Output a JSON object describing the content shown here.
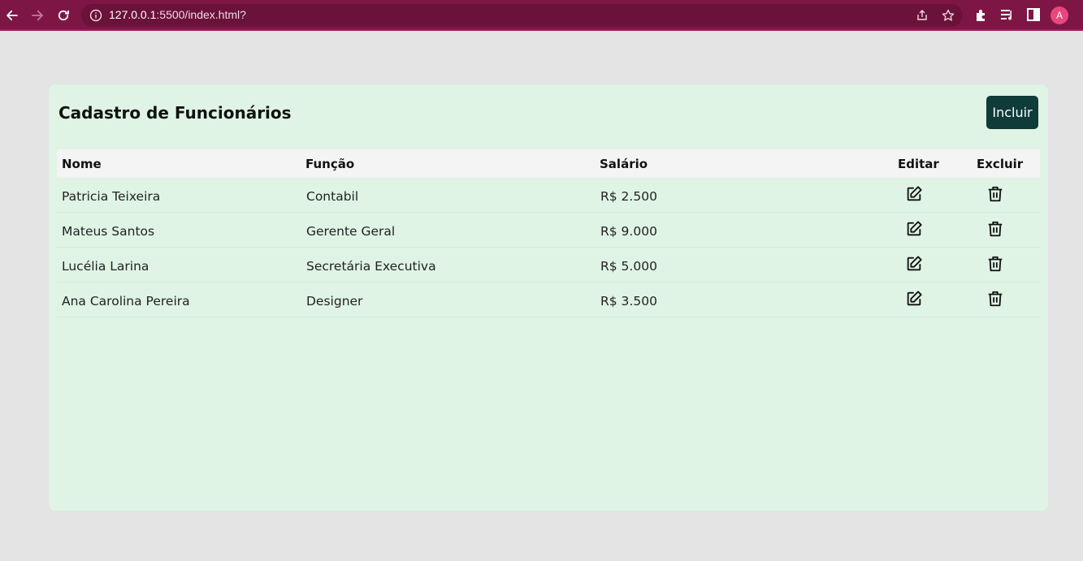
{
  "browser": {
    "url_host": "127.0.0.1",
    "url_rest": ":5500/index.html?",
    "avatar_letter": "A",
    "colors": {
      "toolbar": "#7e1645",
      "omnibox": "#6a1239",
      "avatar": "#e8467c"
    },
    "icons": [
      "back-arrow-icon",
      "forward-arrow-icon",
      "reload-icon",
      "info-icon",
      "share-icon",
      "star-icon",
      "extensions-icon",
      "media-queue-icon",
      "side-panel-icon"
    ]
  },
  "page": {
    "title": "Cadastro de Funcionários",
    "add_label": "Incluir",
    "colors": {
      "card_bg": "#dff4e4",
      "header_bg": "#f4f4f4",
      "button_bg": "#0f3b38",
      "page_bg": "#e4e4e4"
    }
  },
  "table": {
    "headers": {
      "nome": "Nome",
      "funcao": "Função",
      "salario": "Salário",
      "editar": "Editar",
      "excluir": "Excluir"
    },
    "rows": [
      {
        "nome": "Patricia Teixeira",
        "funcao": "Contabil",
        "salario": "R$ 2.500"
      },
      {
        "nome": "Mateus Santos",
        "funcao": "Gerente Geral",
        "salario": "R$ 9.000"
      },
      {
        "nome": "Lucélia Larina",
        "funcao": "Secretária Executiva",
        "salario": "R$ 5.000"
      },
      {
        "nome": "Ana Carolina Pereira",
        "funcao": "Designer",
        "salario": "R$ 3.500"
      }
    ],
    "row_icons": {
      "edit": "edit-icon",
      "delete": "trash-icon"
    }
  }
}
